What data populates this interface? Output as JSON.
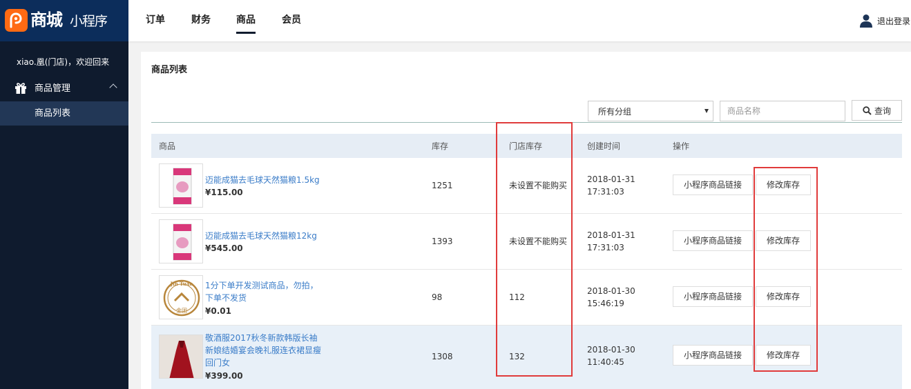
{
  "brand": {
    "big": "商城",
    "small": "小程序",
    "accent": "#ff6a13"
  },
  "sidebar": {
    "welcome": "xiao.凰(门店)，欢迎回来",
    "group_label": "商品管理",
    "group_icon": "gift-icon",
    "active_item": "商品列表"
  },
  "topnav": {
    "items": [
      "订单",
      "财务",
      "商品",
      "会员"
    ],
    "active": "商品",
    "logout": "退出登录"
  },
  "page": {
    "title": "商品列表",
    "category_select": "所有分组",
    "search_placeholder": "商品名称",
    "query_label": "查询"
  },
  "table": {
    "headers": [
      "商品",
      "库存",
      "门店库存",
      "创建时间",
      "操作"
    ],
    "rows": [
      {
        "name": "迈能成猫去毛球天然猫粮1.5kg",
        "price": "¥115.00",
        "stock": "1251",
        "store_stock": "未设置不能购买",
        "date": "2018-01-31",
        "time": "17:31:03",
        "link_btn": "小程序商品链接",
        "edit_btn": "修改库存"
      },
      {
        "name": "迈能成猫去毛球天然猫粮12kg",
        "price": "¥545.00",
        "stock": "1393",
        "store_stock": "未设置不能购买",
        "date": "2018-01-31",
        "time": "17:31:03",
        "link_btn": "小程序商品链接",
        "edit_btn": "修改库存"
      },
      {
        "name": "1分下单开发测试商品，勿拍，下单不发货",
        "name_line1": "1分下单开发测试商品，勿拍，",
        "name_line2": "下单不发货",
        "price": "¥0.01",
        "stock": "98",
        "store_stock": "112",
        "date": "2018-01-30",
        "time": "15:46:19",
        "link_btn": "小程序商品链接",
        "edit_btn": "修改库存",
        "logo_text_top": "Jin Tuan",
        "logo_text_bottom": "金团"
      },
      {
        "name": "敬酒服2017秋冬新款韩版长袖新娘结婚宴会晚礼服连衣裙显瘦回门女",
        "name_line1": "敬酒服2017秋冬新款韩版长袖",
        "name_line2": "新娘结婚宴会晚礼服连衣裙显瘦",
        "name_line3": "回门女",
        "price": "¥399.00",
        "stock": "1308",
        "store_stock": "132",
        "date": "2018-01-30",
        "time": "11:40:45",
        "link_btn": "小程序商品链接",
        "edit_btn": "修改库存"
      }
    ]
  },
  "colors": {
    "sidebar_bg": "#0f1b2e",
    "link": "#3a7cc8",
    "highlight_box": "#e03a3a"
  }
}
